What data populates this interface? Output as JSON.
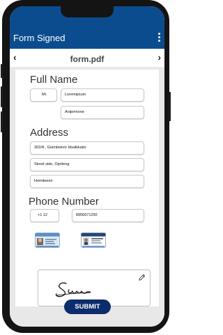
{
  "appbar": {
    "title": "Form Signed",
    "menu_icon": "more-vertical-icon"
  },
  "pdf_bar": {
    "prev_icon": "chevron-left-icon",
    "next_icon": "chevron-right-icon",
    "file_name": "form.pdf"
  },
  "form": {
    "full_name": {
      "heading": "Full Name",
      "title": "Mr.",
      "first_name": "Loremipsum",
      "last_name": "Anijermone"
    },
    "address": {
      "heading": "Address",
      "line1": "302/A , Goimbeinnr Idsalkkatio",
      "line2": "Street side, Opriteng",
      "line3": "Homiteeen"
    },
    "phone": {
      "heading": "Phone Number",
      "country_code": "+1 12",
      "number": "8956671250"
    },
    "id_cards": [
      "id-card-front-icon",
      "id-card-back-icon"
    ],
    "signature": {
      "edit_icon": "pencil-icon"
    }
  },
  "actions": {
    "submit": "SUBMIT"
  },
  "colors": {
    "primary": "#0b4c8f",
    "submit": "#0c2d6b",
    "document_bg": "#e8e8e8"
  }
}
